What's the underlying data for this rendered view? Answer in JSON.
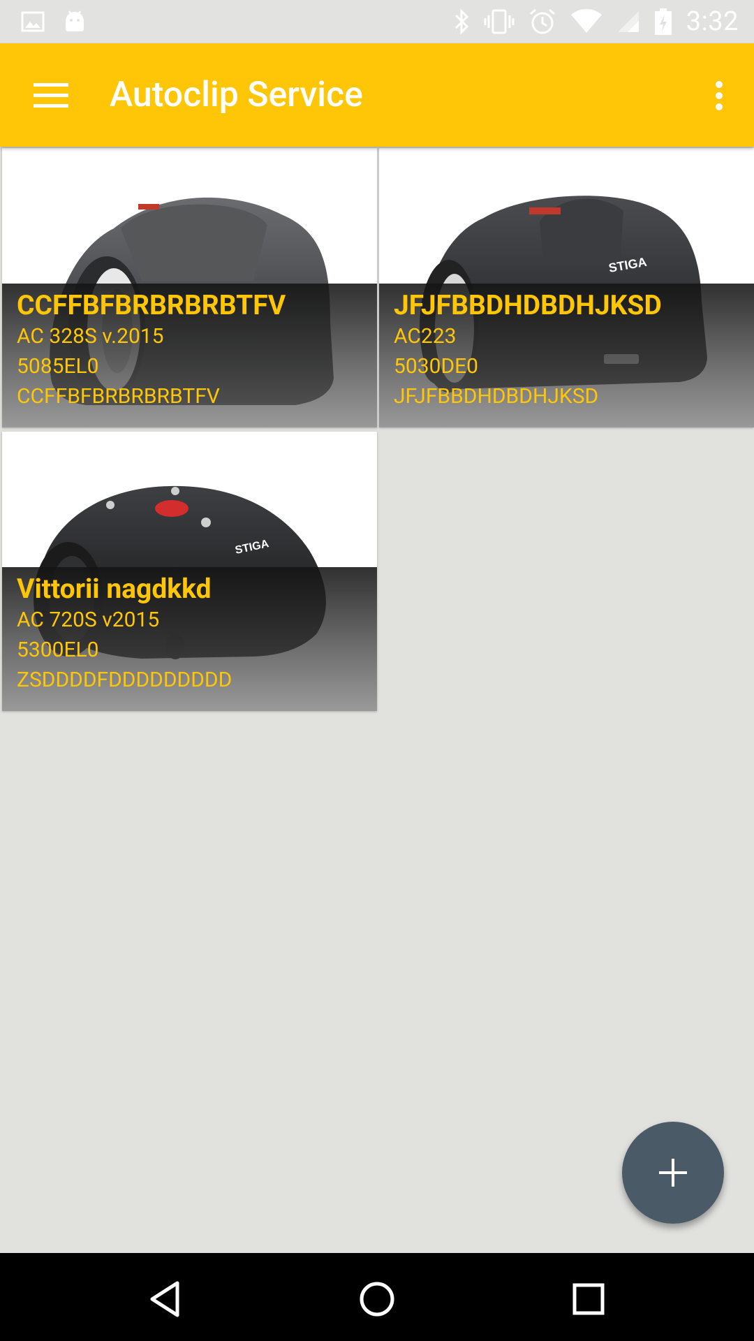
{
  "status_bar": {
    "time": "3:32",
    "left_icons": [
      "image-icon",
      "android-icon"
    ],
    "right_icons": [
      "bluetooth-icon",
      "vibrate-icon",
      "alarm-icon",
      "wifi-icon",
      "signal-icon",
      "battery-charging-icon"
    ]
  },
  "app_bar": {
    "title": "Autoclip Service",
    "background": "#fec606"
  },
  "devices": [
    {
      "name": "CCFFBFBRBRBRBTFV",
      "model": "AC 328S v.2015",
      "code": "5085EL0",
      "serial": "CCFFBFBRBRBRBTFV"
    },
    {
      "name": "JFJFBBDHDBDHJKSD",
      "model": "AC223",
      "code": "5030DE0",
      "serial": "JFJFBBDHDBDHJKSD"
    },
    {
      "name": "Vittorii nagdkkd",
      "model": "AC 720S v2015",
      "code": "5300EL0",
      "serial": "ZSDDDDFDDDDDDDDD"
    }
  ],
  "fab": {
    "icon": "plus-icon"
  },
  "nav_bar": {
    "icons": [
      "back-icon",
      "home-icon",
      "recents-icon"
    ]
  }
}
